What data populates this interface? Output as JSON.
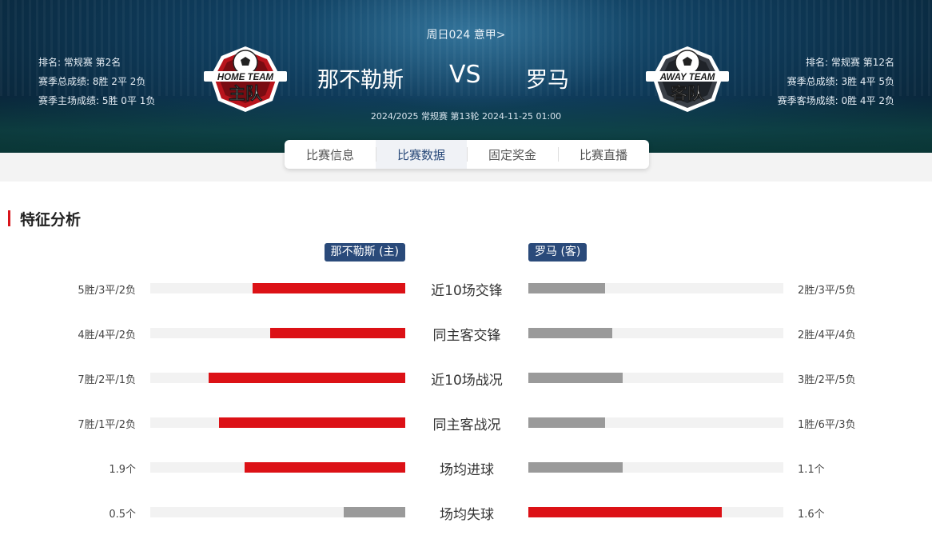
{
  "header": {
    "league_link": "周日024 意甲>",
    "vs": "VS",
    "match_meta": "2024/2025 常规赛 第13轮 2024-11-25 01:00",
    "home": {
      "name": "那不勒斯",
      "badge_line1": "HOME TEAM",
      "badge_line2": "主队",
      "rank": "排名: 常规赛 第2名",
      "season": "赛季总成绩: 8胜 2平 2负",
      "venue": "赛季主场成绩: 5胜 0平 1负"
    },
    "away": {
      "name": "罗马",
      "badge_line1": "AWAY TEAM",
      "badge_line2": "客队",
      "rank": "排名: 常规赛 第12名",
      "season": "赛季总成绩: 3胜 4平 5负",
      "venue": "赛季客场成绩: 0胜 4平 2负"
    }
  },
  "tabs": [
    {
      "label": "比赛信息",
      "active": false
    },
    {
      "label": "比赛数据",
      "active": true
    },
    {
      "label": "固定奖金",
      "active": false
    },
    {
      "label": "比赛直播",
      "active": false
    }
  ],
  "section": {
    "title": "特征分析",
    "home_tag": "那不勒斯 (主)",
    "away_tag": "罗马 (客)"
  },
  "colors": {
    "red": "#dc1116",
    "gray": "#9a9a9a",
    "track": "#f2f2f2",
    "navy": "#2a4a7a"
  },
  "features": [
    {
      "label": "近10场交锋",
      "home_text": "5胜/3平/2负",
      "away_text": "2胜/3平/5负",
      "home_ratio": 0.6,
      "away_ratio": 0.3,
      "home_color": "red",
      "away_color": "gray"
    },
    {
      "label": "同主客交锋",
      "home_text": "4胜/4平/2负",
      "away_text": "2胜/4平/4负",
      "home_ratio": 0.53,
      "away_ratio": 0.33,
      "home_color": "red",
      "away_color": "gray"
    },
    {
      "label": "近10场战况",
      "home_text": "7胜/2平/1负",
      "away_text": "3胜/2平/5负",
      "home_ratio": 0.77,
      "away_ratio": 0.37,
      "home_color": "red",
      "away_color": "gray"
    },
    {
      "label": "同主客战况",
      "home_text": "7胜/1平/2负",
      "away_text": "1胜/6平/3负",
      "home_ratio": 0.73,
      "away_ratio": 0.3,
      "home_color": "red",
      "away_color": "gray"
    },
    {
      "label": "场均进球",
      "home_text": "1.9个",
      "away_text": "1.1个",
      "home_ratio": 0.63,
      "away_ratio": 0.37,
      "home_color": "red",
      "away_color": "gray"
    },
    {
      "label": "场均失球",
      "home_text": "0.5个",
      "away_text": "1.6个",
      "home_ratio": 0.24,
      "away_ratio": 0.76,
      "home_color": "gray",
      "away_color": "red"
    }
  ]
}
